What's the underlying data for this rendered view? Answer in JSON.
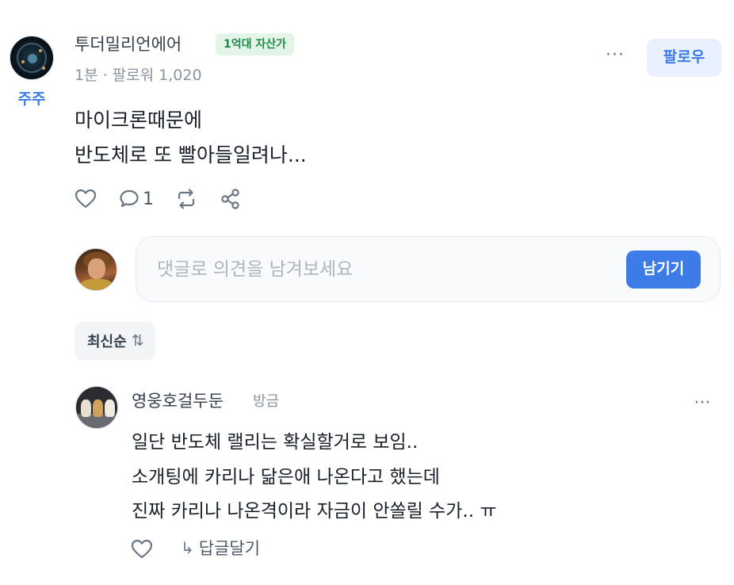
{
  "post": {
    "author": {
      "name": "투더밀리언에어",
      "badge": "1억대 자산가",
      "nickname": "주주"
    },
    "meta": "1분 · 팔로워 1,020",
    "follow_label": "팔로우",
    "more_label": "···",
    "content_lines": [
      "마이크론때문에",
      "반도체로 또 빨아들일려나..."
    ],
    "comment_count": "1"
  },
  "comment_input": {
    "placeholder": "댓글로 의견을 남겨보세요",
    "submit_label": "남기기"
  },
  "sort": {
    "label": "최신순",
    "arrows": "⇅"
  },
  "reply": {
    "name": "영웅호걸두둔",
    "time": "방금",
    "more_label": "···",
    "lines": [
      "일단 반도체 랠리는 확실할거로 보임..",
      "소개팅에 카리나 닮은애 나온다고 했는데",
      "진짜 카리나 나온격이라 자금이 안쏠릴 수가.. ㅠ"
    ],
    "reply_label": "답글달기",
    "reply_arrow": "↳"
  },
  "icons": {
    "accent": "#3d7be6",
    "badge_green": "#1e8a48"
  }
}
